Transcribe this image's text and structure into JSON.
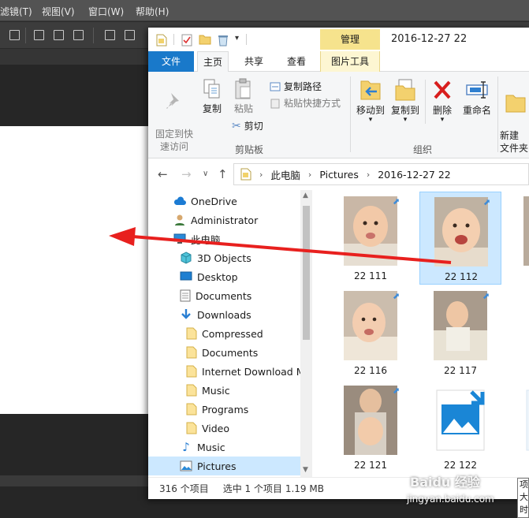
{
  "photoshop": {
    "menu": [
      "滤镜(T)",
      "视图(V)",
      "窗口(W)",
      "帮助(H)"
    ]
  },
  "explorer": {
    "titlebar": {
      "manage_tab": "管理",
      "title": "2016-12-27 22"
    },
    "ribbon_tabs": {
      "file": "文件",
      "home": "主页",
      "share": "共享",
      "view": "查看",
      "picture_tools": "图片工具"
    },
    "ribbon": {
      "pin": "固定到快\n速访问",
      "copy": "复制",
      "paste": "粘贴",
      "copy_path": "复制路径",
      "paste_shortcut": "粘贴快捷方式",
      "cut": "剪切",
      "clipboard_group": "剪贴板",
      "move_to": "移动到",
      "copy_to": "复制到",
      "delete": "删除",
      "rename": "重命名",
      "organize_group": "组织",
      "new_folder": "新建\n文件夹"
    },
    "address": {
      "crumbs": [
        "此电脑",
        "Pictures",
        "2016-12-27 22"
      ]
    },
    "nav": {
      "items": [
        {
          "label": "OneDrive",
          "icon": "cloud-icon"
        },
        {
          "label": "Administrator",
          "icon": "user-icon"
        },
        {
          "label": "此电脑",
          "icon": "computer-icon"
        },
        {
          "label": "3D Objects",
          "icon": "cube-icon"
        },
        {
          "label": "Desktop",
          "icon": "desktop-icon"
        },
        {
          "label": "Documents",
          "icon": "document-icon"
        },
        {
          "label": "Downloads",
          "icon": "download-icon"
        },
        {
          "label": "Compressed",
          "icon": "folder-icon"
        },
        {
          "label": "Documents",
          "icon": "folder-icon"
        },
        {
          "label": "Internet Download M",
          "icon": "folder-icon"
        },
        {
          "label": "Music",
          "icon": "folder-icon"
        },
        {
          "label": "Programs",
          "icon": "folder-icon"
        },
        {
          "label": "Video",
          "icon": "folder-icon"
        },
        {
          "label": "Music",
          "icon": "music-icon"
        },
        {
          "label": "Pictures",
          "icon": "pictures-icon"
        }
      ]
    },
    "files": [
      {
        "name": "22 111",
        "selected": false
      },
      {
        "name": "22 112",
        "selected": true
      },
      {
        "name": "22 116",
        "selected": false
      },
      {
        "name": "22 117",
        "selected": false
      },
      {
        "name": "22 121",
        "selected": false
      },
      {
        "name": "22 122",
        "selected": false
      }
    ],
    "status": {
      "count": "316 个项目",
      "selection": "选中 1 个项目  1.19 MB"
    },
    "tooltip": "项\n大\n时"
  },
  "watermark": {
    "brand": "Baidu 经验",
    "url": "jingyan.baidu.com"
  },
  "colors": {
    "accent": "#1979ca",
    "selection": "#cce8ff",
    "manage": "#f6e38d",
    "arrow": "#e8201e"
  }
}
